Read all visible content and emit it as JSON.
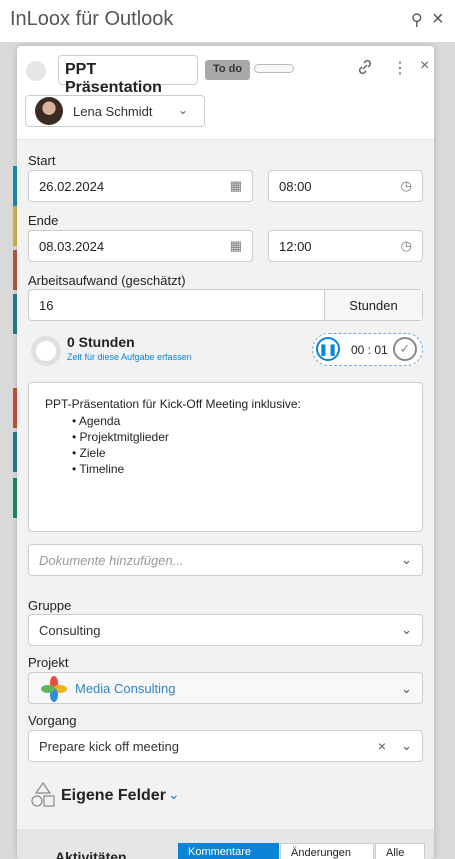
{
  "pane": {
    "title": "InLoox für Outlook",
    "pin_icon": "pin-icon",
    "close_icon": "close-icon"
  },
  "task": {
    "title": "PPT Präsentation",
    "status": "To do",
    "assignee": "Lena Schmidt"
  },
  "fields": {
    "start_label": "Start",
    "start_date": "26.02.2024",
    "start_time": "08:00",
    "end_label": "Ende",
    "end_date": "08.03.2024",
    "end_time": "12:00",
    "effort_label": "Arbeitsaufwand (geschätzt)",
    "effort_value": "16",
    "effort_unit": "Stunden"
  },
  "time_tracking": {
    "hours": "0 Stunden",
    "link": "Zeit für diese Aufgabe erfassen",
    "timer": "00 : 01"
  },
  "description": {
    "intro": "PPT-Präsentation für Kick-Off Meeting inklusive:",
    "items": [
      "• Agenda",
      "• Projektmitglieder",
      "• Ziele",
      "• Timeline"
    ]
  },
  "documents": {
    "placeholder": "Dokumente hinzufügen..."
  },
  "group": {
    "label": "Gruppe",
    "value": "Consulting"
  },
  "project": {
    "label": "Projekt",
    "value": "Media Consulting"
  },
  "process": {
    "label": "Vorgang",
    "value": "Prepare kick off meeting"
  },
  "custom_fields": {
    "label": "Eigene Felder"
  },
  "activities": {
    "label": "Aktivitäten",
    "tabs": [
      "Kommentare",
      "Änderungen",
      "Alle"
    ]
  },
  "colors": {
    "accent": "#0a84d6",
    "badge": "#a8a8a8"
  }
}
